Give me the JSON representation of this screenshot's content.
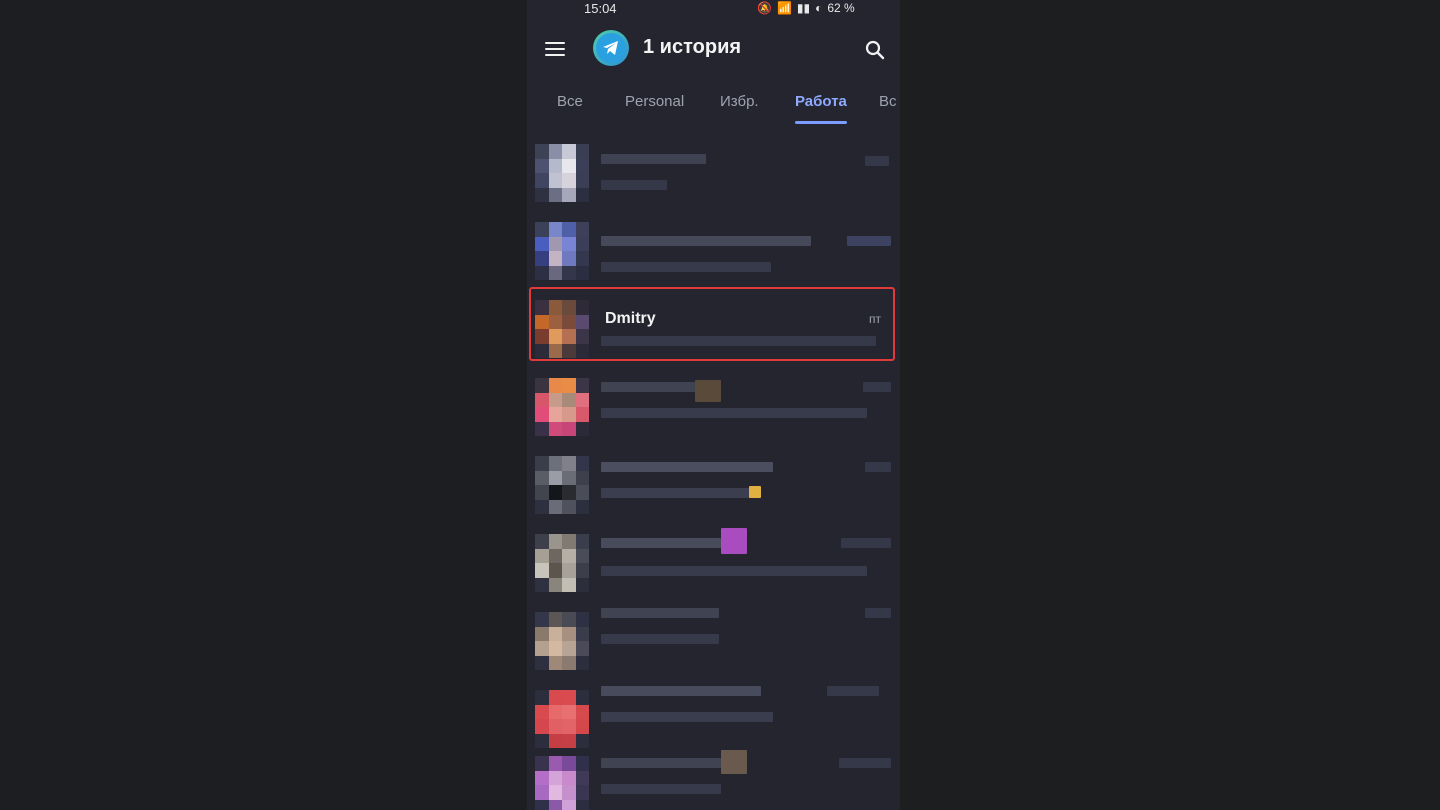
{
  "status_bar": {
    "time": "15:04",
    "battery": "62 %"
  },
  "app_bar": {
    "title": "1 история",
    "menu_icon": "hamburger-menu-icon",
    "logo_icon": "telegram-logo-icon",
    "search_icon": "search-icon"
  },
  "tabs": [
    {
      "label": "Все"
    },
    {
      "label": "Personal"
    },
    {
      "label": "Избр."
    },
    {
      "label": "Работа"
    },
    {
      "label": "Вс"
    }
  ],
  "active_tab": "Работа",
  "highlighted_chat": {
    "name": "Dmitry",
    "date": "пт"
  },
  "colors": {
    "accent": "#8fa9ff",
    "highlight_border": "#e03a3a"
  }
}
